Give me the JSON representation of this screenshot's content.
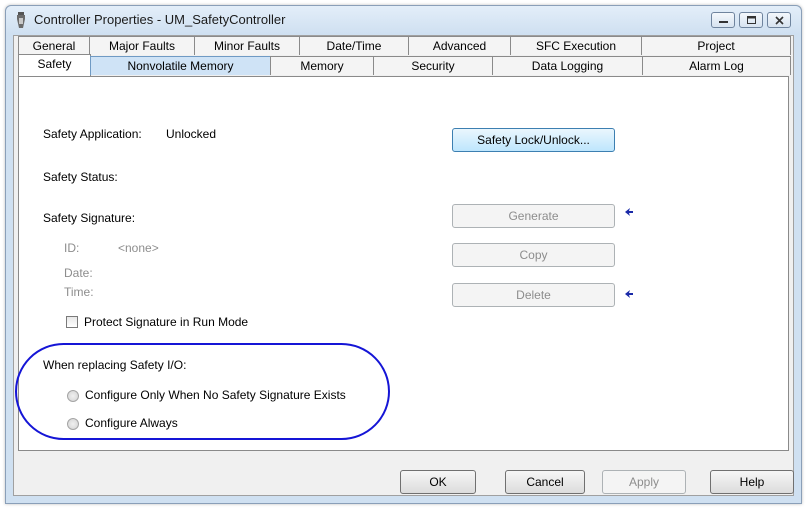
{
  "window": {
    "title": "Controller Properties - UM_SafetyController"
  },
  "tabs_row1": [
    "General",
    "Major Faults",
    "Minor Faults",
    "Date/Time",
    "Advanced",
    "SFC Execution",
    "Project"
  ],
  "tabs_row2": [
    "Safety",
    "Nonvolatile Memory",
    "Memory",
    "Security",
    "Data Logging",
    "Alarm Log"
  ],
  "safety": {
    "application_label": "Safety Application:",
    "application_value": "Unlocked",
    "lock_button": "Safety Lock/Unlock...",
    "status_label": "Safety Status:",
    "signature_label": "Safety Signature:",
    "generate_button": "Generate",
    "id_label": "ID:",
    "id_value": "<none>",
    "copy_button": "Copy",
    "date_label": "Date:",
    "time_label": "Time:",
    "delete_button": "Delete",
    "protect_checkbox": "Protect Signature in Run Mode",
    "replacing_label": "When replacing Safety I/O:",
    "radio_option_1": "Configure Only When No Safety Signature Exists",
    "radio_option_2": "Configure Always"
  },
  "footer": {
    "ok": "OK",
    "cancel": "Cancel",
    "apply": "Apply",
    "help": "Help"
  },
  "colors": {
    "highlight_annotation": "#1515d6",
    "selected_tab_hover": "#cfe3f6"
  },
  "icons": [
    "app-icon",
    "minimize-icon",
    "maximize-icon",
    "close-icon",
    "arrow-left-icon"
  ]
}
